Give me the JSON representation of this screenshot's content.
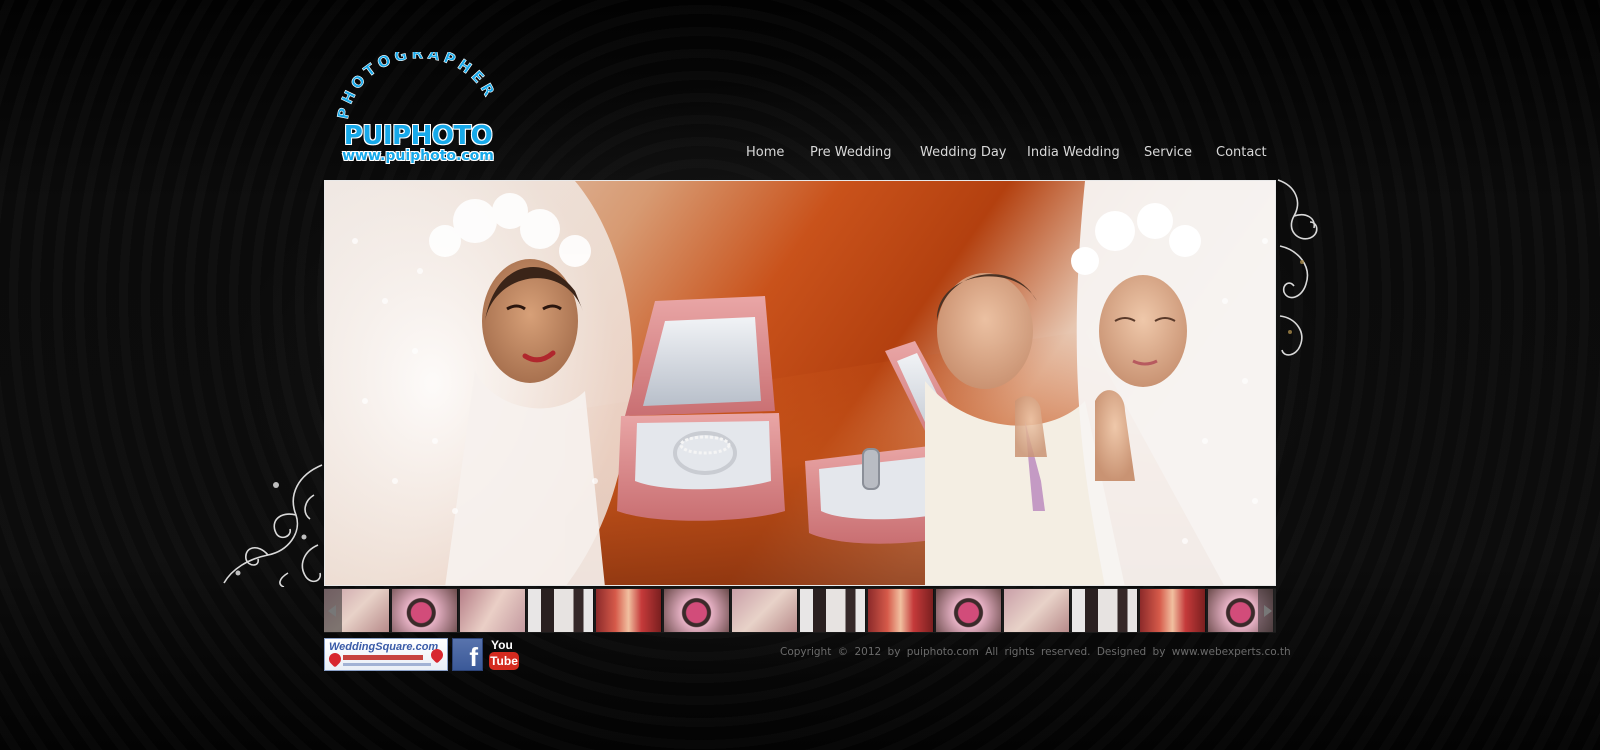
{
  "logo": {
    "arc_text": "PHOTOGRAPHER",
    "name": "PUIPHOTO",
    "url": "www.puiphoto.com"
  },
  "nav": {
    "items": [
      {
        "label": "Home"
      },
      {
        "label": "Pre Wedding"
      },
      {
        "label": "Wedding Day"
      },
      {
        "label": "India Wedding"
      },
      {
        "label": "Service"
      },
      {
        "label": "Contact"
      }
    ]
  },
  "hero": {
    "alt": "Bride in lace veil, wedding rings in pink boxes, groom and bride praying"
  },
  "filmstrip": {
    "thumbnail_count": 14
  },
  "footer": {
    "weddingsquare_label": "WeddingSquare.com",
    "facebook_label": "f",
    "youtube_you": "You",
    "youtube_tube": "Tube",
    "copyright": "Copyright © 2012 by puiphoto.com All rights reserved. Designed by www.webexperts.co.th"
  },
  "colors": {
    "logo_blue": "#17a9ea",
    "nav_text": "#d8d8d8",
    "copyright_text": "#6b6b6b",
    "background": "#0b0b0b"
  }
}
